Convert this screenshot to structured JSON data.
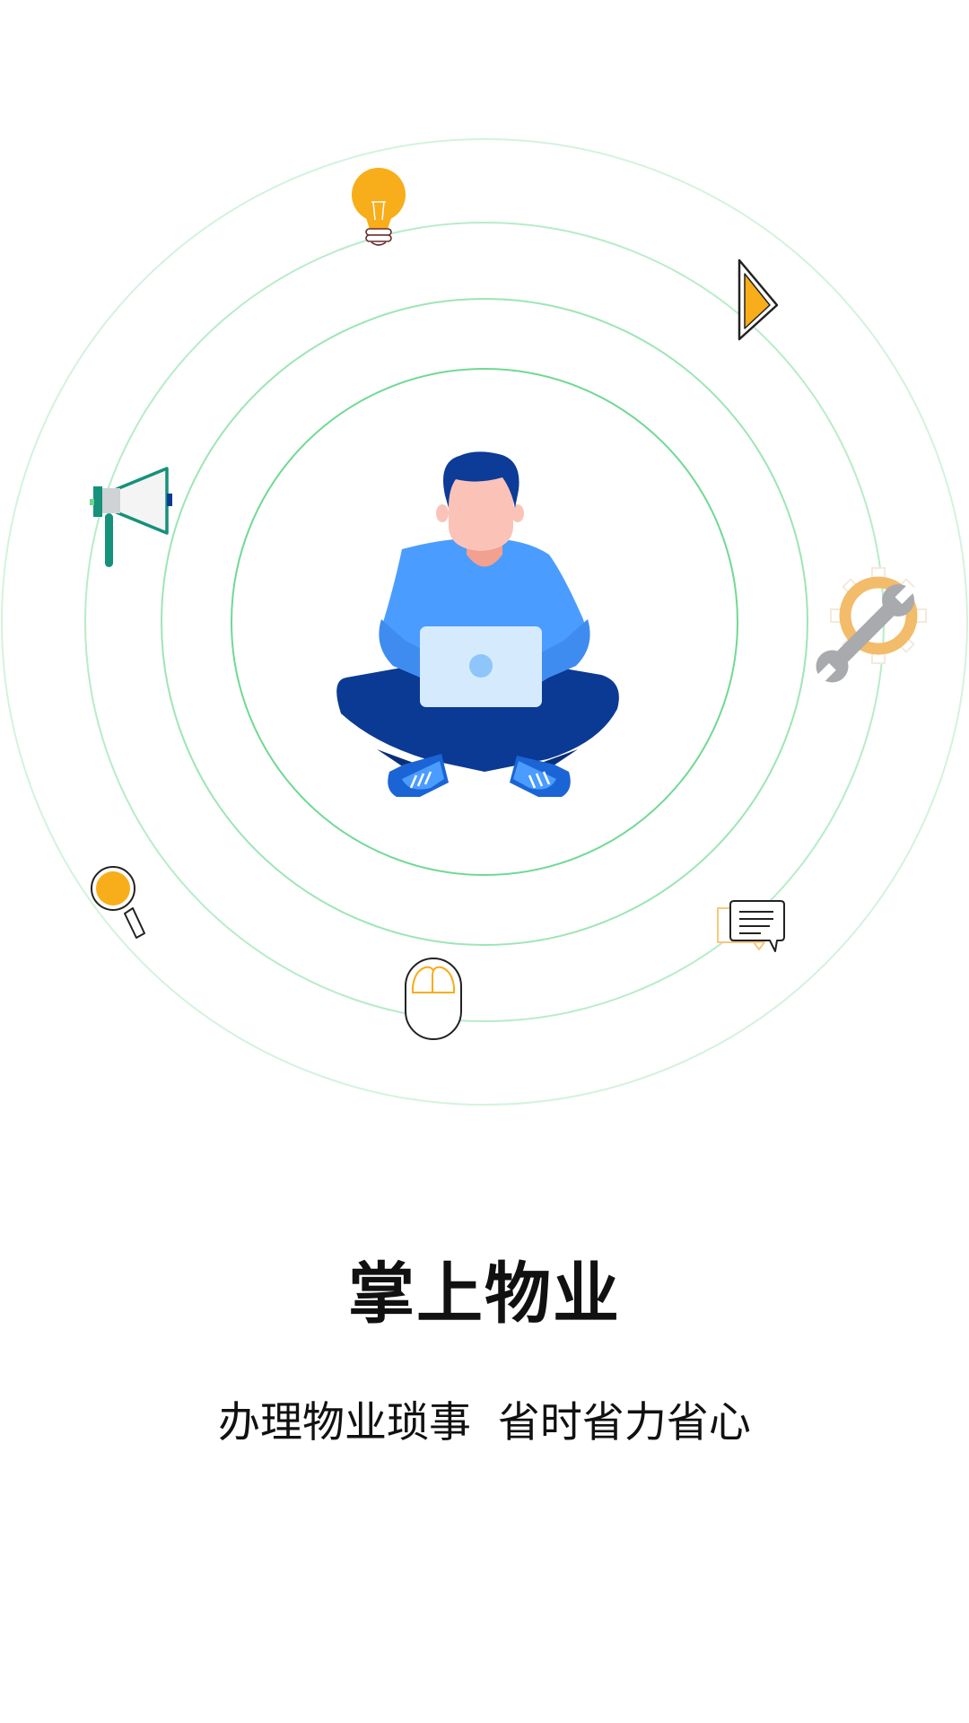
{
  "splash": {
    "title": "掌上物业",
    "subtitle": "办理物业琐事  省时省力省心"
  },
  "colors": {
    "ring_green": "#4ccf78",
    "shirt_blue": "#4a9cff",
    "pants_navy": "#0a3a93",
    "hair_navy": "#0c3b98",
    "skin": "#fbc3b8",
    "laptop": "#d6eafd",
    "icon_yellow": "#f8ad1a",
    "teal": "#16917a",
    "wrench_gray": "#a8aaad"
  },
  "icons": [
    "lightbulb-icon",
    "cursor-arrow-icon",
    "megaphone-icon",
    "wrench-gear-icon",
    "magnifier-icon",
    "chat-bubble-icon",
    "mouse-icon"
  ]
}
